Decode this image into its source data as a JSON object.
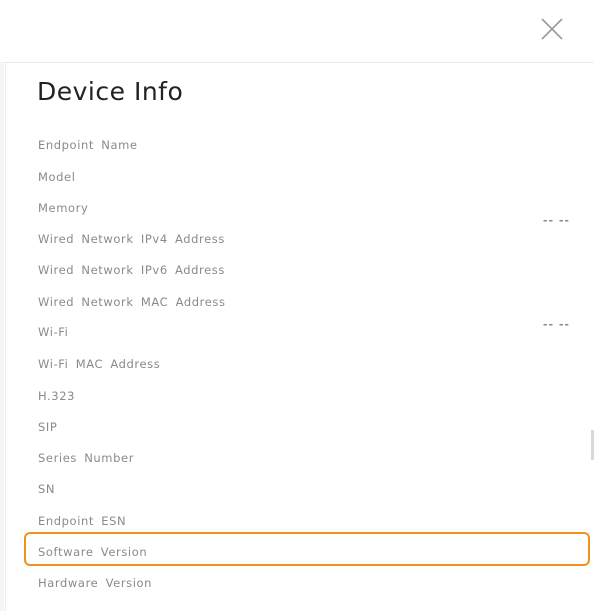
{
  "dialog": {
    "title": "Device Info",
    "close_icon": "close-icon"
  },
  "fields": [
    {
      "label": "Endpoint Name",
      "value": ""
    },
    {
      "label": "Model",
      "value": ""
    },
    {
      "label": "Memory",
      "value": "-- --"
    },
    {
      "label": "Wired Network IPv4 Address",
      "value": ""
    },
    {
      "label": "Wired Network IPv6 Address",
      "value": ""
    },
    {
      "label": "Wired Network MAC Address",
      "value": ""
    },
    {
      "label": "Wi-Fi",
      "value": "-- --"
    },
    {
      "label": "Wi-Fi MAC Address",
      "value": ""
    },
    {
      "label": "H.323",
      "value": ""
    },
    {
      "label": "SIP",
      "value": ""
    },
    {
      "label": "Series Number",
      "value": ""
    },
    {
      "label": "SN",
      "value": ""
    },
    {
      "label": "Endpoint ESN",
      "value": ""
    },
    {
      "label": "Software Version",
      "value": ""
    },
    {
      "label": "Hardware Version",
      "value": ""
    }
  ],
  "highlight": {
    "field": "Software Version",
    "color": "#f0921e"
  }
}
